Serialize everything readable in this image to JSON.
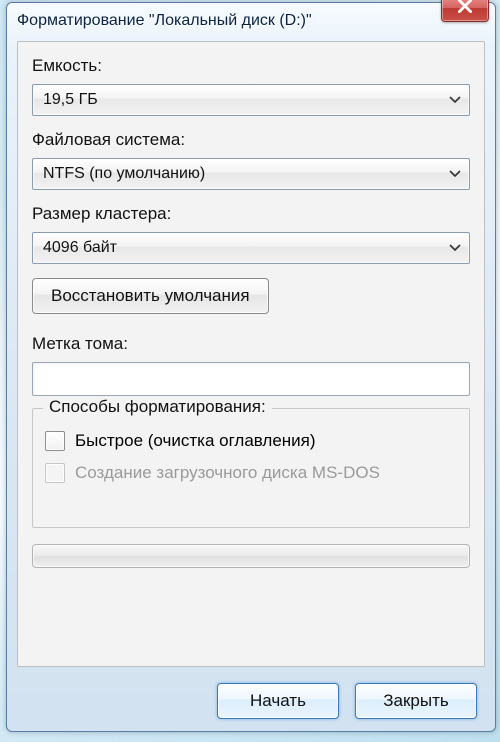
{
  "window": {
    "title": "Форматирование \"Локальный диск (D:)\""
  },
  "labels": {
    "capacity": "Емкость:",
    "filesystem": "Файловая система:",
    "cluster": "Размер кластера:",
    "volume_label": "Метка тома:"
  },
  "fields": {
    "capacity_value": "19,5 ГБ",
    "filesystem_value": "NTFS (по умолчанию)",
    "cluster_value": "4096 байт",
    "volume_label_value": ""
  },
  "buttons": {
    "restore_defaults": "Восстановить умолчания",
    "start": "Начать",
    "close": "Закрыть"
  },
  "group": {
    "legend": "Способы форматирования:",
    "quick_format": "Быстрое (очистка оглавления)",
    "msdos_boot": "Создание загрузочного диска MS-DOS"
  },
  "state": {
    "quick_format_checked": false,
    "msdos_enabled": false
  }
}
